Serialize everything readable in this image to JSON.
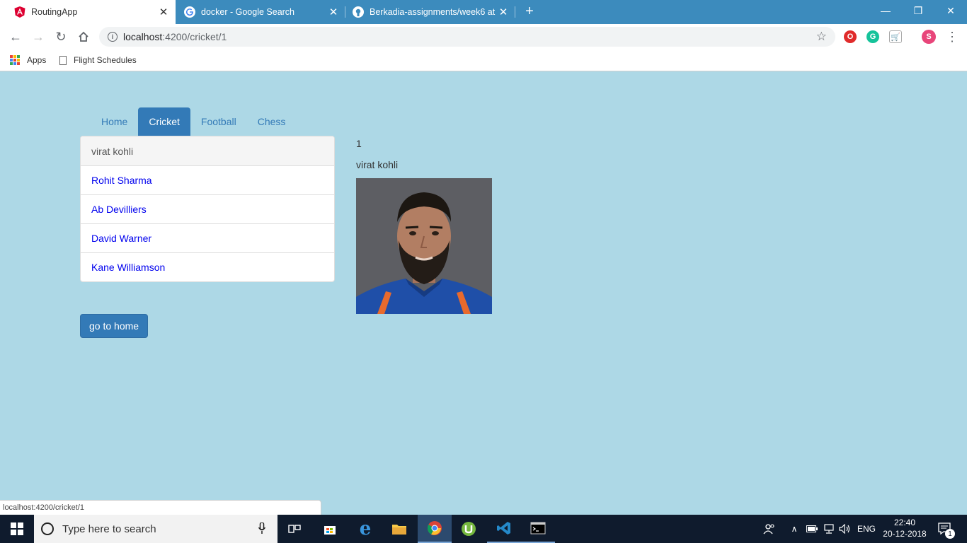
{
  "browser": {
    "tabs": [
      {
        "title": "RoutingApp",
        "favicon": "angular-icon",
        "active": true
      },
      {
        "title": "docker - Google Search",
        "favicon": "google-icon",
        "active": false
      },
      {
        "title": "Berkadia-assignments/week6 at",
        "favicon": "github-icon",
        "active": false
      }
    ],
    "url_host": "localhost",
    "url_path": ":4200/cricket/1",
    "bookmarks": {
      "apps_label": "Apps",
      "flight_label": "Flight Schedules"
    },
    "profile_initial": "S",
    "status_url": "localhost:4200/cricket/1"
  },
  "page": {
    "nav": {
      "home": "Home",
      "cricket": "Cricket",
      "football": "Football",
      "chess": "Chess"
    },
    "players": [
      "virat kohli",
      "Rohit Sharma",
      "Ab Devilliers",
      "David Warner",
      "Kane Williamson"
    ],
    "detail": {
      "id": "1",
      "name": "virat kohli"
    },
    "home_button": "go to home"
  },
  "taskbar": {
    "search_placeholder": "Type here to search",
    "language": "ENG",
    "time": "22:40",
    "date": "20-12-2018",
    "notification_count": "1"
  },
  "colors": {
    "page_bg": "#add8e6",
    "primary": "#337ab7",
    "chrome_frame": "#3c8bbd",
    "link": "#0000ee"
  }
}
